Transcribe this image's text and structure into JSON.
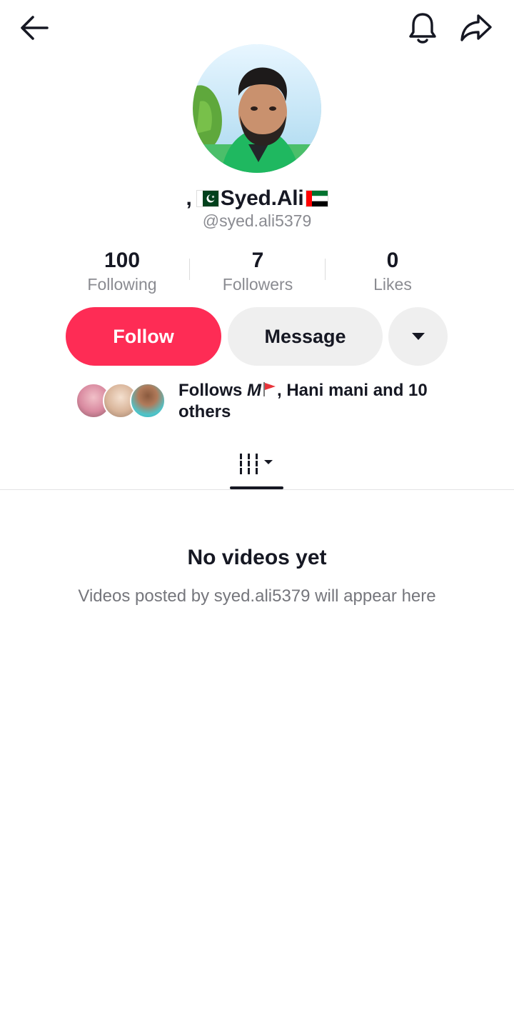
{
  "header": {
    "back_icon": "arrow-left-icon",
    "bell_icon": "bell-icon",
    "share_icon": "share-arrow-icon"
  },
  "profile": {
    "name_prefix": ",",
    "display_name": "Syed.Ali",
    "flags": [
      "pakistan-flag",
      "uae-flag"
    ],
    "username": "@syed.ali5379"
  },
  "stats": [
    {
      "value": "100",
      "label": "Following"
    },
    {
      "value": "7",
      "label": "Followers"
    },
    {
      "value": "0",
      "label": "Likes"
    }
  ],
  "actions": {
    "follow_label": "Follow",
    "message_label": "Message",
    "more_icon": "caret-down-icon"
  },
  "mutual": {
    "prefix": "Follows ",
    "first_name": "M",
    "rest": ", Hani mani and 10 others"
  },
  "tabs": {
    "videos_icon": "video-grid-icon"
  },
  "empty_state": {
    "title": "No videos yet",
    "description": "Videos posted by syed.ali5379 will appear here"
  },
  "colors": {
    "accent": "#fe2c55",
    "secondary_button": "#efefef",
    "muted_text": "#8a8b91"
  }
}
